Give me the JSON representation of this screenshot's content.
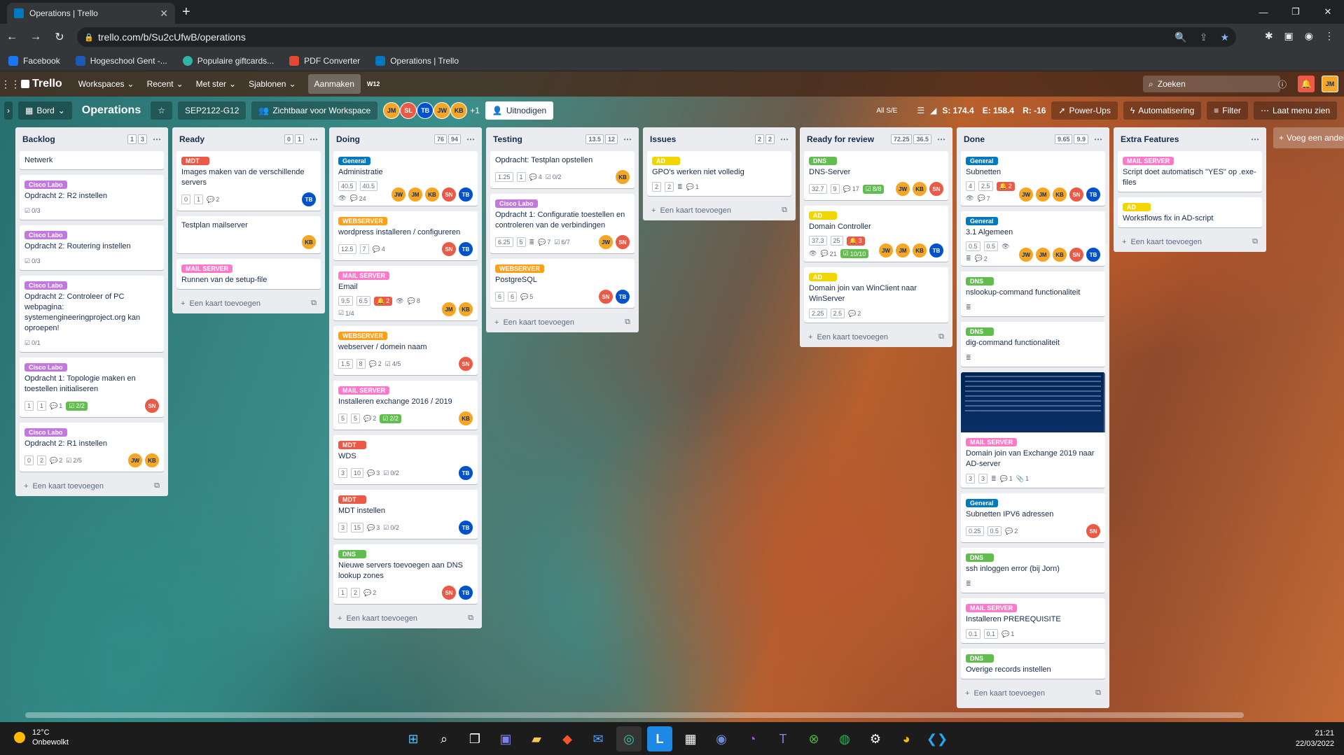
{
  "browser": {
    "tab_title": "Operations | Trello",
    "url": "trello.com/b/Su2cUfwB/operations",
    "bookmarks": [
      "Facebook",
      "Hogeschool Gent -...",
      "Populaire giftcards...",
      "PDF Converter",
      "Operations | Trello"
    ]
  },
  "nav": {
    "logo": "Trello",
    "workspaces": "Workspaces",
    "recent": "Recent",
    "starred": "Met ster",
    "templates": "Sjablonen",
    "create": "Aanmaken",
    "search_placeholder": "Zoeken",
    "user": "JM",
    "plugin": "W12"
  },
  "board": {
    "view": "Bord",
    "title": "Operations",
    "workspace": "SEP2122-G12",
    "visibility": "Zichtbaar voor Workspace",
    "member_extra": "+1",
    "invite": "Uitnodigen",
    "filter_all": "All S/E",
    "stat_s": "S: 174.4",
    "stat_e": "E: 158.4",
    "stat_r": "R: -16",
    "powerups": "Power-Ups",
    "automation": "Automatisering",
    "filter": "Filter",
    "menu": "Laat menu zien"
  },
  "add_card": "Een kaart toevoegen",
  "add_list": "Voeg een ander",
  "colors": {
    "purple": "#c377e0",
    "red": "#eb5a46",
    "orange": "#ff9f1a",
    "pink": "#ff78cb",
    "green": "#61bd4f",
    "yellow": "#f2d600",
    "blue": "#0079bf"
  },
  "lists": [
    {
      "title": "Backlog",
      "c1": "1",
      "c2": "3",
      "cards": [
        {
          "label": "",
          "title": "Netwerk"
        },
        {
          "label": "Cisco Labo",
          "lc": "purple",
          "title": "Opdracht 2: R2 instellen",
          "checklist": "0/3"
        },
        {
          "label": "Cisco Labo",
          "lc": "purple",
          "title": "Opdracht 2: Routering instellen",
          "checklist": "0/3"
        },
        {
          "label": "Cisco Labo",
          "lc": "purple",
          "title": "Opdracht 2: Controleer of PC webpagina: systemengineeringproject.org kan oproepen!",
          "checklist": "0/1"
        },
        {
          "label": "Cisco Labo",
          "lc": "purple",
          "title": "Opdracht 1: Topologie maken en toestellen initialiseren",
          "p1": "1",
          "p2": "1",
          "comments": "1",
          "checklist_done": "2/2",
          "members": [
            "SN"
          ]
        },
        {
          "label": "Cisco Labo",
          "lc": "purple",
          "title": "Opdracht 2: R1 instellen",
          "p1": "0",
          "p2": "2",
          "comments": "2",
          "checklist": "2/5",
          "members": [
            "JW",
            "KB"
          ]
        }
      ]
    },
    {
      "title": "Ready",
      "c1": "0",
      "c2": "1",
      "cards": [
        {
          "label": "MDT",
          "lc": "red",
          "title": "Images maken van de verschillende servers",
          "p1": "0",
          "p2": "1",
          "comments": "2",
          "members": [
            "TB"
          ]
        },
        {
          "label": "",
          "title": "Testplan mailserver",
          "members": [
            "KB"
          ]
        },
        {
          "label": "MAIL SERVER",
          "lc": "pink",
          "title": "Runnen van de setup-file"
        }
      ]
    },
    {
      "title": "Doing",
      "c1": "76",
      "c2": "94",
      "cards": [
        {
          "label": "General",
          "lc": "blue",
          "title": "Administratie",
          "p1": "40.5",
          "p2": "40.5",
          "watch": "1",
          "comments": "24",
          "members": [
            "JW",
            "JM",
            "KB",
            "SN",
            "TB"
          ]
        },
        {
          "label": "WEBSERVER",
          "lc": "orange",
          "title": "wordpress installeren / configureren",
          "p1": "12.5",
          "p2": "7",
          "comments": "4",
          "members": [
            "SN",
            "TB"
          ]
        },
        {
          "label": "MAIL SERVER",
          "lc": "pink",
          "title": "Email",
          "p1": "9.5",
          "p2": "6.5",
          "alert": "2",
          "watch": "1",
          "comments": "8",
          "checklist": "1/4",
          "members": [
            "JM",
            "KB"
          ]
        },
        {
          "label": "WEBSERVER",
          "lc": "orange",
          "title": "webserver / domein naam",
          "p1": "1.5",
          "p2": "8",
          "comments": "2",
          "checklist": "4/5",
          "members": [
            "SN"
          ]
        },
        {
          "label": "MAIL SERVER",
          "lc": "pink",
          "title": "Installeren exchange 2016 / 2019",
          "p1": "5",
          "p2": "5",
          "comments": "2",
          "checklist_done": "2/2",
          "members": [
            "KB"
          ]
        },
        {
          "label": "MDT",
          "lc": "red",
          "title": "WDS",
          "p1": "3",
          "p2": "10",
          "comments": "3",
          "checklist": "0/2",
          "members": [
            "TB"
          ]
        },
        {
          "label": "MDT",
          "lc": "red",
          "title": "MDT instellen",
          "p1": "3",
          "p2": "15",
          "comments": "3",
          "checklist": "0/2",
          "members": [
            "TB"
          ]
        },
        {
          "label": "DNS",
          "lc": "green",
          "title": "Nieuwe servers toevoegen aan DNS lookup zones",
          "p1": "1",
          "p2": "2",
          "comments": "2",
          "members": [
            "SN",
            "TB"
          ]
        }
      ]
    },
    {
      "title": "Testing",
      "c1": "13.5",
      "c2": "12",
      "cards": [
        {
          "label": "",
          "title": "Opdracht: Testplan opstellen",
          "p1": "1.25",
          "p2": "1",
          "comments": "4",
          "checklist": "0/2",
          "members": [
            "KB"
          ]
        },
        {
          "label": "Cisco Labo",
          "lc": "purple",
          "title": "Opdracht 1: Configuratie toestellen en controleren van de verbindingen",
          "p1": "6.25",
          "p2": "5",
          "desc": "1",
          "comments": "7",
          "checklist": "6/7",
          "members": [
            "JW",
            "SN"
          ]
        },
        {
          "label": "WEBSERVER",
          "lc": "orange",
          "title": "PostgreSQL",
          "p1": "6",
          "p2": "6",
          "comments": "5",
          "members": [
            "SN",
            "TB"
          ]
        }
      ]
    },
    {
      "title": "Issues",
      "c1": "2",
      "c2": "2",
      "cards": [
        {
          "label": "AD",
          "lc": "yellow",
          "title": "GPO's werken niet volledig",
          "p1": "2",
          "p2": "2",
          "desc": "1",
          "comments": "1"
        }
      ]
    },
    {
      "title": "Ready for review",
      "c1": "72.25",
      "c2": "36.5",
      "cards": [
        {
          "label": "DNS",
          "lc": "green",
          "title": "DNS-Server",
          "p1": "32.7",
          "p2": "9",
          "comments": "17",
          "checklist_done": "8/8",
          "members": [
            "JW",
            "KB",
            "SN"
          ]
        },
        {
          "label": "AD",
          "lc": "yellow",
          "title": "Domain Controller",
          "p1": "37.3",
          "p2": "25",
          "alert": "3",
          "watch": "1",
          "comments": "21",
          "checklist_done": "10/10",
          "members": [
            "JW",
            "JM",
            "KB",
            "TB"
          ]
        },
        {
          "label": "AD",
          "lc": "yellow",
          "title": "Domain join van WinClient naar WinServer",
          "p1": "2.25",
          "p2": "2.5",
          "comments": "2"
        }
      ]
    },
    {
      "title": "Done",
      "c1": "9.65",
      "c2": "9.9",
      "cards": [
        {
          "label": "General",
          "lc": "blue",
          "title": "Subnetten",
          "p1": "4",
          "p2": "2.5",
          "alert": "2",
          "watch": "1",
          "comments": "7",
          "members": [
            "JW",
            "JM",
            "KB",
            "SN",
            "TB"
          ]
        },
        {
          "label": "General",
          "lc": "blue",
          "title": "3.1 Algemeen",
          "p1": "0.5",
          "p2": "0.5",
          "watch": "1",
          "desc": "1",
          "comments": "2",
          "members": [
            "JW",
            "JM",
            "KB",
            "SN",
            "TB"
          ]
        },
        {
          "label": "DNS",
          "lc": "green",
          "title": "nslookup-command functionaliteit",
          "desc": "1"
        },
        {
          "label": "DNS",
          "lc": "green",
          "title": "dig-command functionaliteit",
          "desc": "1"
        },
        {
          "label": "MAIL SERVER",
          "lc": "pink",
          "title": "Domain join van Exchange 2019 naar AD-server",
          "p1": "3",
          "p2": "3",
          "desc": "1",
          "comments": "1",
          "attach": "1",
          "image": "1"
        },
        {
          "label": "General",
          "lc": "blue",
          "title": "Subnetten IPV6 adressen",
          "p1": "0.25",
          "p2": "0.5",
          "comments": "2",
          "members": [
            "SN"
          ]
        },
        {
          "label": "DNS",
          "lc": "green",
          "title": "ssh inloggen error (bij Jorn)",
          "desc": "1"
        },
        {
          "label": "MAIL SERVER",
          "lc": "pink",
          "title": "Installeren PREREQUISITE",
          "p1": "0.1",
          "p2": "0.1",
          "comments": "1"
        },
        {
          "label": "DNS",
          "lc": "green",
          "title": "Overige records instellen"
        }
      ]
    },
    {
      "title": "Extra Features",
      "c1": "",
      "c2": "",
      "cards": [
        {
          "label": "MAIL SERVER",
          "lc": "pink",
          "title": "Script doet automatisch \"YES\" op .exe-files"
        },
        {
          "label": "AD",
          "lc": "yellow",
          "title": "Worksflows fix in AD-script"
        }
      ]
    }
  ],
  "taskbar": {
    "temp": "12°C",
    "weather": "Onbewolkt",
    "time": "21:21",
    "date": "22/03/2022"
  }
}
